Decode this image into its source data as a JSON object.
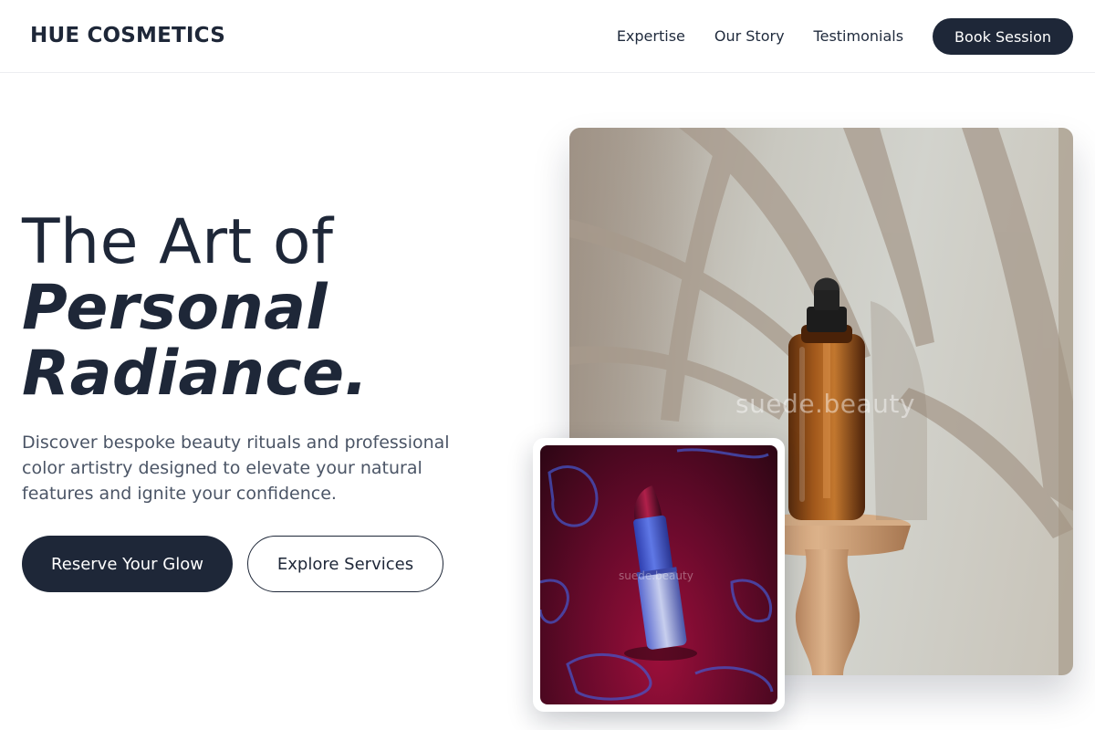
{
  "header": {
    "brand": "HUE COSMETICS",
    "nav": [
      {
        "label": "Expertise"
      },
      {
        "label": "Our Story"
      },
      {
        "label": "Testimonials"
      }
    ],
    "cta_label": "Book Session"
  },
  "hero": {
    "title_line1": "The Art of",
    "title_line2": "Personal",
    "title_line3": "Radiance.",
    "description": "Discover bespoke beauty rituals and professional color artistry designed to elevate your natural features and ignite your confidence.",
    "primary_button": "Reserve Your Glow",
    "secondary_button": "Explore Services"
  },
  "images": {
    "main_watermark": "suede.beauty",
    "inset_watermark": "suede.beauty"
  },
  "colors": {
    "primary": "#1e2738",
    "text_muted": "#4b5566",
    "background": "#ffffff"
  }
}
